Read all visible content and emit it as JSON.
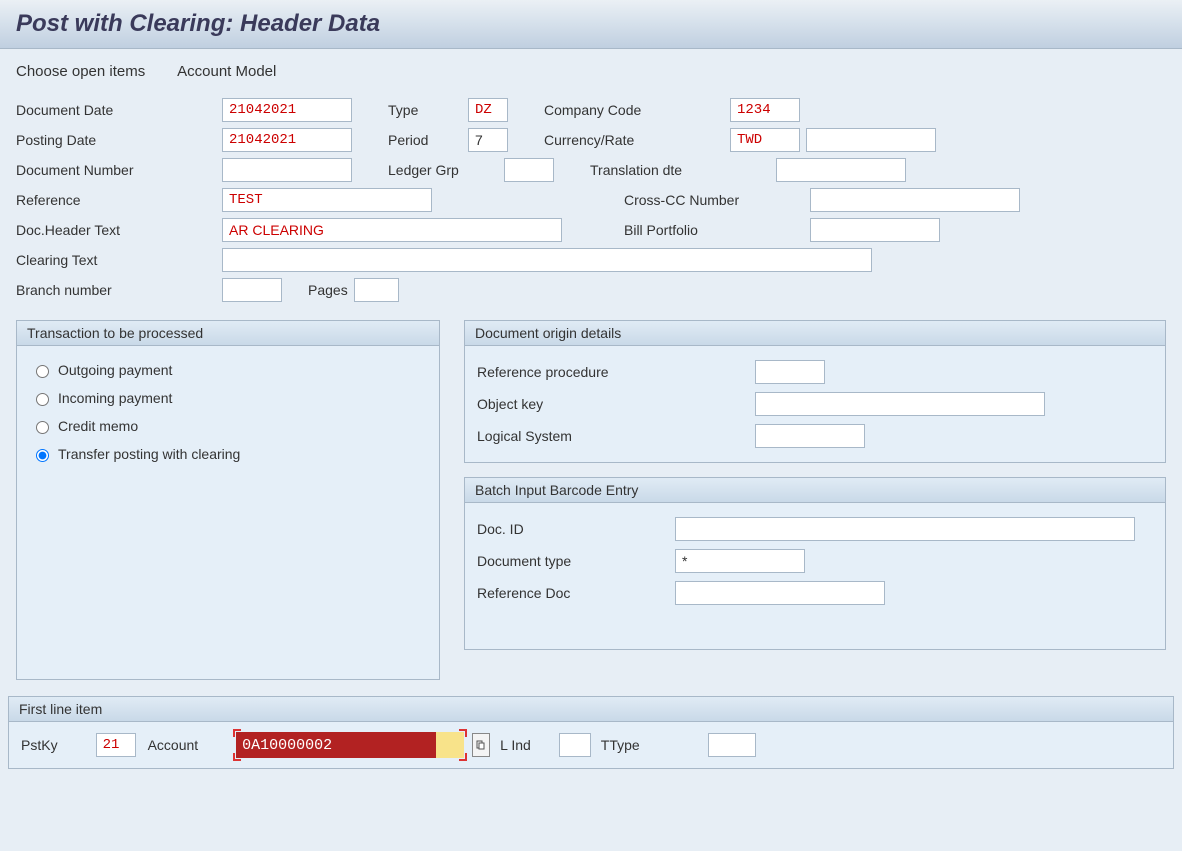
{
  "title": "Post with Clearing: Header Data",
  "toolbar": {
    "choose_open_items": "Choose open items",
    "account_model": "Account Model"
  },
  "header": {
    "document_date_label": "Document Date",
    "document_date": "21042021",
    "type_label": "Type",
    "type": "DZ",
    "company_code_label": "Company Code",
    "company_code": "1234",
    "posting_date_label": "Posting Date",
    "posting_date": "21042021",
    "period_label": "Period",
    "period": "7",
    "currency_rate_label": "Currency/Rate",
    "currency": "TWD",
    "rate": "",
    "document_number_label": "Document Number",
    "document_number": "",
    "ledger_grp_label": "Ledger Grp",
    "ledger_grp": "",
    "translation_dte_label": "Translation dte",
    "translation_dte": "",
    "reference_label": "Reference",
    "reference": "TEST",
    "cross_cc_label": "Cross-CC Number",
    "cross_cc": "",
    "doc_header_text_label": "Doc.Header Text",
    "doc_header_text": "AR CLEARING",
    "bill_portfolio_label": "Bill Portfolio",
    "bill_portfolio": "",
    "clearing_text_label": "Clearing Text",
    "clearing_text": "",
    "branch_number_label": "Branch number",
    "branch_number": "",
    "pages_label": "Pages",
    "pages": ""
  },
  "transaction": {
    "title": "Transaction to be processed",
    "outgoing_payment": "Outgoing payment",
    "incoming_payment": "Incoming payment",
    "credit_memo": "Credit memo",
    "transfer_posting": "Transfer posting with clearing",
    "selected": "transfer_posting"
  },
  "origin": {
    "title": "Document origin details",
    "ref_procedure_label": "Reference procedure",
    "ref_procedure": "",
    "object_key_label": "Object key",
    "object_key": "",
    "logical_system_label": "Logical System",
    "logical_system": ""
  },
  "barcode": {
    "title": "Batch Input Barcode Entry",
    "doc_id_label": "Doc. ID",
    "doc_id": "",
    "document_type_label": "Document type",
    "document_type": "*",
    "reference_doc_label": "Reference Doc",
    "reference_doc": ""
  },
  "first_line": {
    "title": "First line item",
    "pstky_label": "PstKy",
    "pstky": "21",
    "account_label": "Account",
    "account": "0A10000002",
    "sgl_ind_label": "L Ind",
    "sgl_ind": "",
    "ttype_label": "TType",
    "ttype": ""
  }
}
